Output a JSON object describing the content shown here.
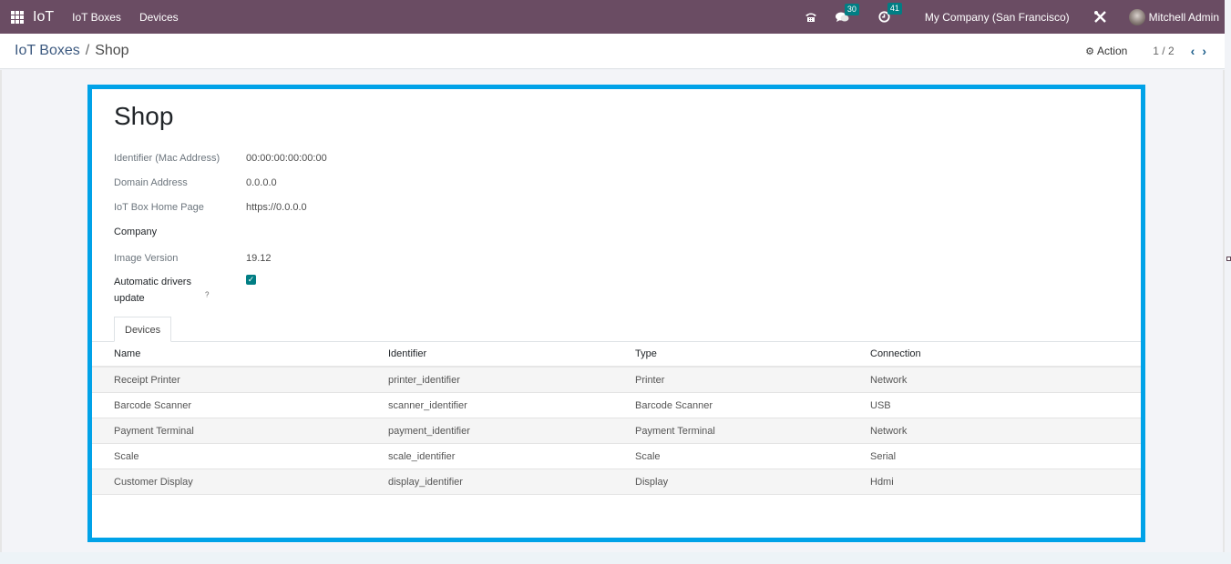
{
  "navbar": {
    "app_name": "IoT",
    "menus": [
      "IoT Boxes",
      "Devices"
    ],
    "messages_count": "30",
    "activities_count": "41",
    "company": "My Company (San Francisco)",
    "user": "Mitchell Admin",
    "icons": {
      "apps": "grid-icon",
      "phone": "phone-icon",
      "messages": "chat-icon",
      "activities": "clock-icon",
      "debug": "tools-icon"
    }
  },
  "control_panel": {
    "breadcrumb_parent": "IoT Boxes",
    "breadcrumb_separator": "/",
    "breadcrumb_current": "Shop",
    "action_label": "Action",
    "pager": "1 / 2"
  },
  "form": {
    "title": "Shop",
    "fields": [
      {
        "label": "Identifier (Mac Address)",
        "value": "00:00:00:00:00:00"
      },
      {
        "label": "Domain Address",
        "value": "0.0.0.0"
      },
      {
        "label": "IoT Box Home Page",
        "value": "https://0.0.0.0"
      },
      {
        "label": "Company",
        "value": ""
      },
      {
        "label": "Image Version",
        "value": "19.12"
      }
    ],
    "auto_update_label": "Automatic drivers update",
    "auto_update_help": "?",
    "auto_update_checked": true,
    "tab_label": "Devices"
  },
  "devices_table": {
    "columns": [
      "Name",
      "Identifier",
      "Type",
      "Connection"
    ],
    "rows": [
      [
        "Receipt Printer",
        "printer_identifier",
        "Printer",
        "Network"
      ],
      [
        "Barcode Scanner",
        "scanner_identifier",
        "Barcode Scanner",
        "USB"
      ],
      [
        "Payment Terminal",
        "payment_identifier",
        "Payment Terminal",
        "Network"
      ],
      [
        "Scale",
        "scale_identifier",
        "Scale",
        "Serial"
      ],
      [
        "Customer Display",
        "display_identifier",
        "Display",
        "Hdmi"
      ]
    ]
  },
  "colors": {
    "navbar": "#6a4c63",
    "accent": "#017e84",
    "highlight_border": "#00a2e8"
  }
}
